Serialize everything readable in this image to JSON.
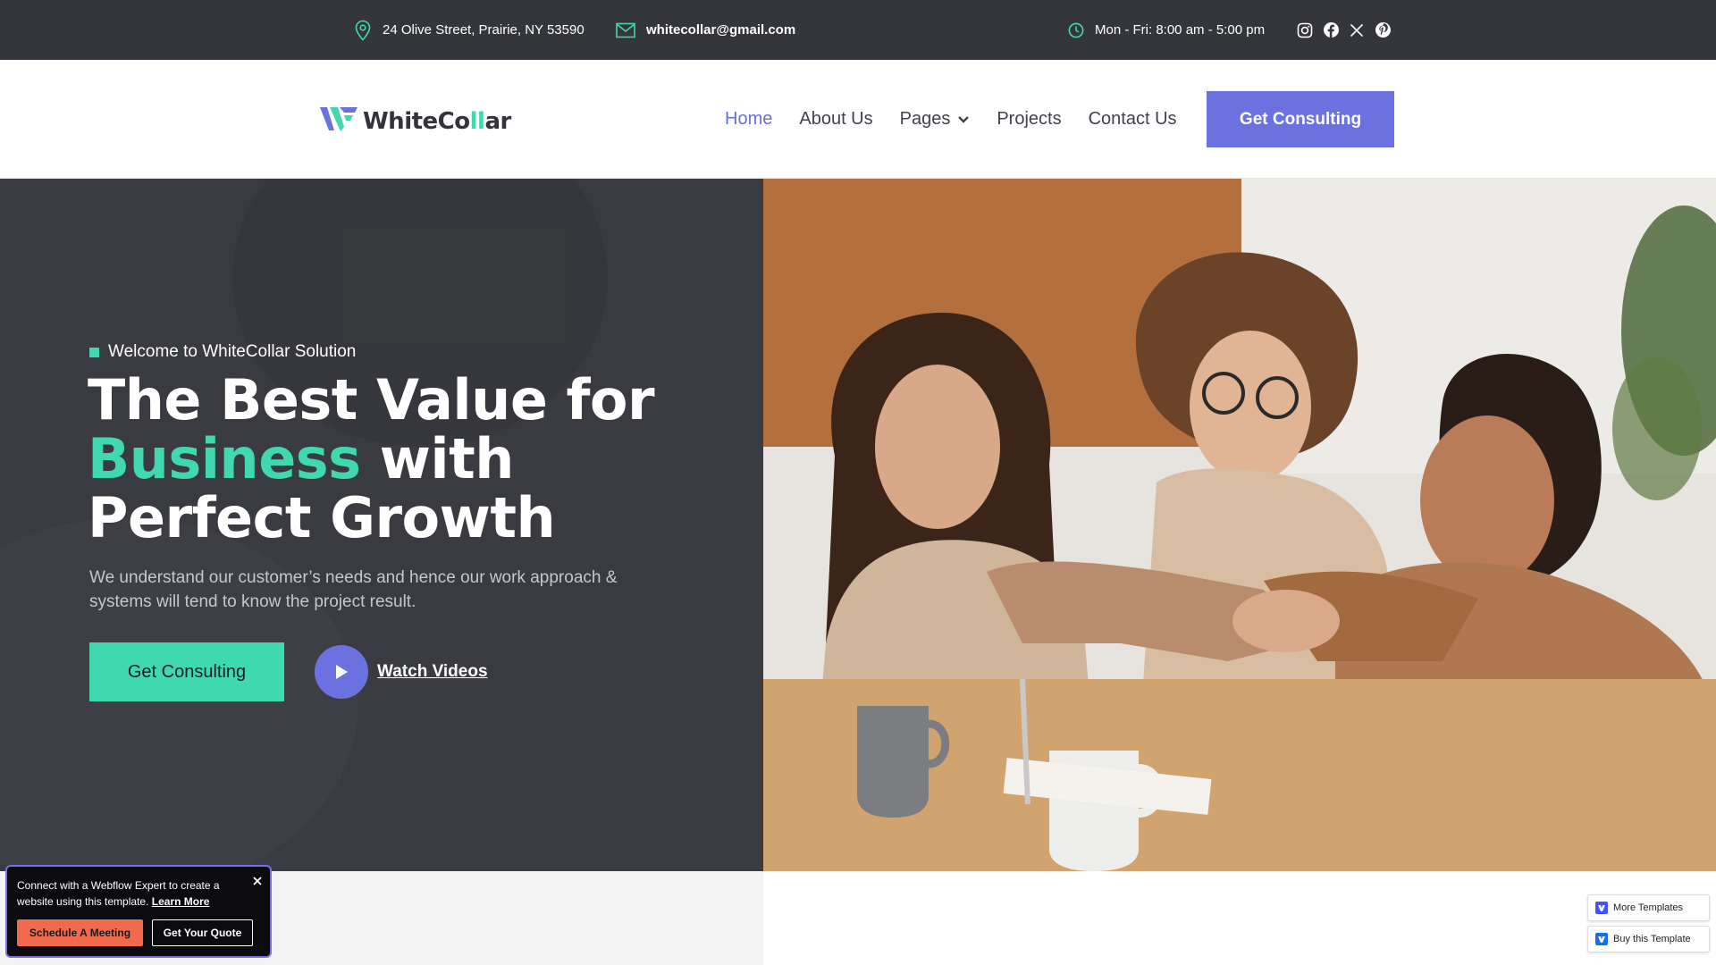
{
  "topbar": {
    "address": "24 Olive Street, Prairie, NY 53590",
    "email": "whitecollar@gmail.com",
    "hours": "Mon - Fri: 8:00 am - 5:00 pm",
    "socials": [
      "instagram-icon",
      "facebook-icon",
      "x-icon",
      "pinterest-icon"
    ]
  },
  "header": {
    "logo_main": "WhiteCo",
    "logo_accent": "ll",
    "logo_end": "ar",
    "nav": [
      {
        "label": "Home",
        "active": true
      },
      {
        "label": "About Us"
      },
      {
        "label": "Pages",
        "has_dropdown": true
      },
      {
        "label": "Projects"
      },
      {
        "label": "Contact Us"
      }
    ],
    "cta": "Get Consulting"
  },
  "hero": {
    "eyebrow": "Welcome to WhiteCollar Solution",
    "headline_line1": "The Best Value for",
    "headline_accent": "Business",
    "headline_line2_rest": " with",
    "headline_line3": "Perfect Growth",
    "subtext": "We understand our customer’s needs and hence our work approach & systems will tend to know the project result.",
    "cta": "Get Consulting",
    "video_label": "Watch Videos"
  },
  "popup": {
    "text": "Connect with a Webflow Expert to create a website using this template.",
    "link": "Learn More",
    "btn_primary": "Schedule A Meeting",
    "btn_secondary": "Get Your Quote"
  },
  "template_buttons": {
    "more": "More Templates",
    "buy": "Buy this Template"
  },
  "colors": {
    "accent_green": "#3fd8b0",
    "accent_purple": "#6b72e0",
    "dark_bg": "#3a3b40",
    "topbar_bg": "#35363b"
  }
}
